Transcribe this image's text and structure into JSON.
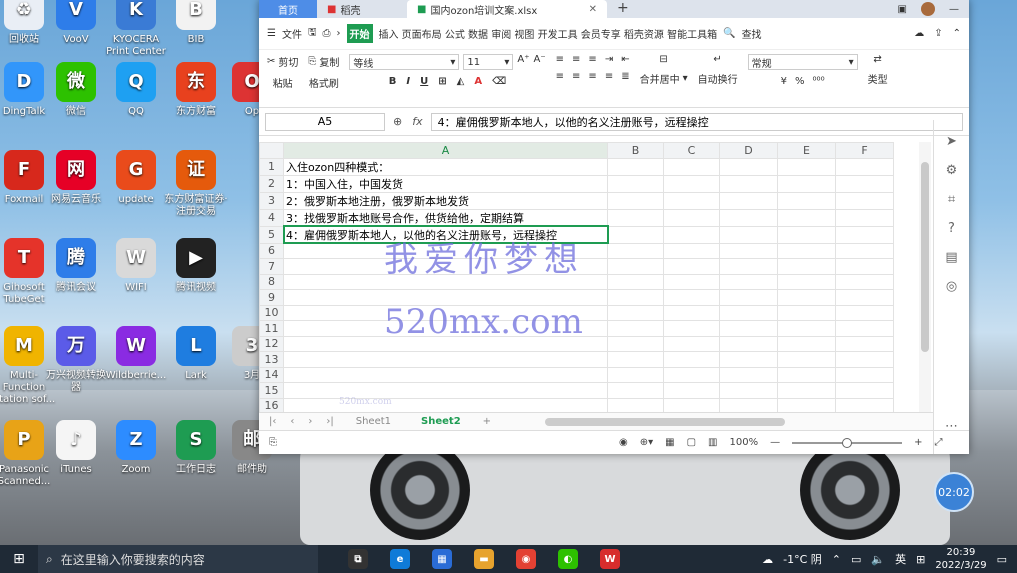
{
  "desktop_icons": [
    {
      "label": "回收站",
      "color": "#e9eef5",
      "glyph": "♻"
    },
    {
      "label": "VooV",
      "color": "#2e7de9",
      "glyph": "V"
    },
    {
      "label": "KYOCERA Print Center",
      "color": "#3a7bd5",
      "glyph": "K"
    },
    {
      "label": "BIB",
      "color": "#f2f2f2",
      "glyph": "B"
    },
    {
      "label": "DingTalk",
      "color": "#3296fa",
      "glyph": "D"
    },
    {
      "label": "微信",
      "color": "#2dc100",
      "glyph": "微"
    },
    {
      "label": "QQ",
      "color": "#1ea0f2",
      "glyph": "Q"
    },
    {
      "label": "东方财富",
      "color": "#e8411e",
      "glyph": "东"
    },
    {
      "label": "Op",
      "color": "#d33",
      "glyph": "O"
    },
    {
      "label": "Foxmail",
      "color": "#d7281c",
      "glyph": "F"
    },
    {
      "label": "网易云音乐",
      "color": "#e60026",
      "glyph": "网"
    },
    {
      "label": "update",
      "color": "#e94b1b",
      "glyph": "G"
    },
    {
      "label": "东方财富证券·注册交易",
      "color": "#e55a0c",
      "glyph": "证"
    },
    {
      "label": "Gihosoft TubeGet",
      "color": "#e5332a",
      "glyph": "T"
    },
    {
      "label": "腾讯会议",
      "color": "#2e7de9",
      "glyph": "腾"
    },
    {
      "label": "WIFI",
      "color": "#d9d9d9",
      "glyph": "W"
    },
    {
      "label": "腾讯视频",
      "color": "#222",
      "glyph": "▶"
    },
    {
      "label": "Multi-Function Station sof...",
      "color": "#f0b400",
      "glyph": "M"
    },
    {
      "label": "万兴视频转换器",
      "color": "#5b5be8",
      "glyph": "万"
    },
    {
      "label": "Wildberrie...",
      "color": "#8a2be2",
      "glyph": "W"
    },
    {
      "label": "Lark",
      "color": "#1f7de0",
      "glyph": "L"
    },
    {
      "label": "3月",
      "color": "#cccccc",
      "glyph": "3"
    },
    {
      "label": "Panasonic Scanned...",
      "color": "#e8a317",
      "glyph": "P"
    },
    {
      "label": "iTunes",
      "color": "#f5f5f5",
      "glyph": "♪"
    },
    {
      "label": "Zoom",
      "color": "#2d8cff",
      "glyph": "Z"
    },
    {
      "label": "工作日志",
      "color": "#1e9c52",
      "glyph": "S"
    },
    {
      "label": "邮件助",
      "color": "#888",
      "glyph": "邮"
    }
  ],
  "window": {
    "tabs": [
      {
        "label": "首页"
      },
      {
        "label": "稻壳"
      },
      {
        "label": "国内ozon培训文案.xlsx"
      }
    ],
    "menu": {
      "file": "文件",
      "start": "开始",
      "items": "插入 页面布局 公式 数据 审阅 视图 开发工具 会员专享 稻壳资源 智能工具箱",
      "search": "查找"
    },
    "ribbon": {
      "cut": "剪切",
      "paste": "粘贴",
      "copy": "复制",
      "format_painter": "格式刷",
      "font_name": "等线",
      "font_size": "11",
      "merge": "合并居中",
      "wrap": "自动换行",
      "number_format": "常规",
      "type_convert": "类型"
    },
    "formula_bar": {
      "name_box": "A5",
      "fx_label": "fx",
      "content": "4：雇佣俄罗斯本地人，以他的名义注册账号，远程操控"
    },
    "columns": [
      "A",
      "B",
      "C",
      "D",
      "E",
      "F"
    ],
    "rows": [
      {
        "n": "1",
        "a": "入住ozon四种模式："
      },
      {
        "n": "2",
        "a": "1：中国入住，中国发货"
      },
      {
        "n": "3",
        "a": "2：俄罗斯本地注册，俄罗斯本地发货"
      },
      {
        "n": "4",
        "a": "3：找俄罗斯本地账号合作，供货给他，定期结算"
      },
      {
        "n": "5",
        "a": "4：雇佣俄罗斯本地人，以他的名义注册账号，远程操控"
      },
      {
        "n": "6",
        "a": ""
      },
      {
        "n": "7",
        "a": ""
      },
      {
        "n": "8",
        "a": ""
      },
      {
        "n": "9",
        "a": ""
      },
      {
        "n": "10",
        "a": ""
      },
      {
        "n": "11",
        "a": ""
      },
      {
        "n": "12",
        "a": ""
      },
      {
        "n": "13",
        "a": ""
      },
      {
        "n": "14",
        "a": ""
      },
      {
        "n": "15",
        "a": ""
      },
      {
        "n": "16",
        "a": ""
      }
    ],
    "sheets": [
      "Sheet1",
      "Sheet2"
    ],
    "zoom": "100%"
  },
  "watermark": {
    "big": "我爱你梦想",
    "url": "520mx.com",
    "small": "520mx.com"
  },
  "clock_bubble": "02:02",
  "taskbar": {
    "search_placeholder": "在这里输入你要搜索的内容",
    "weather": "-1°C 阴",
    "ime": "英",
    "time": "20:39",
    "date": "2022/3/29"
  }
}
